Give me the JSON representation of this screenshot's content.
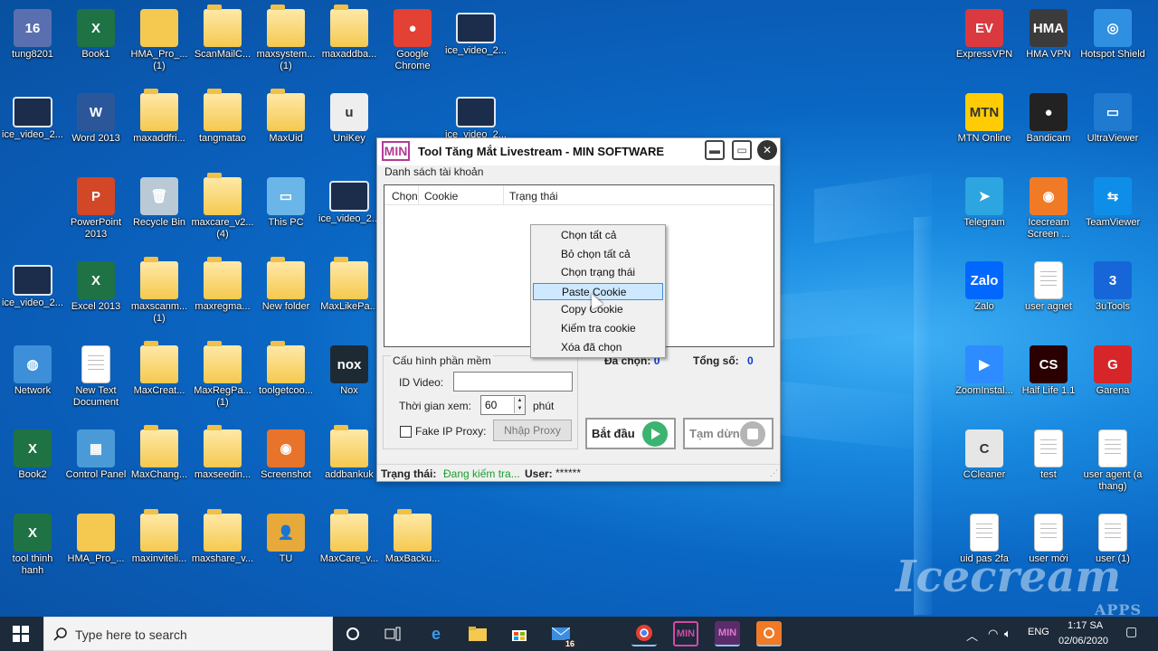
{
  "desktop": {
    "icons": [
      {
        "id": "tung8201",
        "label": "tung8201",
        "kind": "app",
        "color": "#5a6fb0",
        "glyph": "16"
      },
      {
        "id": "book1",
        "label": "Book1",
        "kind": "app",
        "color": "#1f7244",
        "glyph": "X"
      },
      {
        "id": "hma-pro-1",
        "label": "HMA_Pro_... (1)",
        "kind": "app",
        "color": "#f5c94f",
        "glyph": ""
      },
      {
        "id": "scanmailc",
        "label": "ScanMailC...",
        "kind": "folder"
      },
      {
        "id": "maxsystem-1",
        "label": "maxsystem... (1)",
        "kind": "folder"
      },
      {
        "id": "maxaddba",
        "label": "maxaddba...",
        "kind": "folder"
      },
      {
        "id": "google-chrome",
        "label": "Google Chrome",
        "kind": "app",
        "color": "#e34133",
        "glyph": "●"
      },
      {
        "id": "ice-video-1",
        "label": "ice_video_2...",
        "kind": "shot"
      },
      {
        "id": "ice-video-2",
        "label": "ice_video_2...",
        "kind": "shot"
      },
      {
        "id": "word-2013",
        "label": "Word 2013",
        "kind": "app",
        "color": "#2b579a",
        "glyph": "W"
      },
      {
        "id": "maxaddfri",
        "label": "maxaddfri...",
        "kind": "folder"
      },
      {
        "id": "tangmatao",
        "label": "tangmatao",
        "kind": "folder"
      },
      {
        "id": "maxuid",
        "label": "MaxUid",
        "kind": "folder"
      },
      {
        "id": "unikey",
        "label": "UniKey",
        "kind": "app",
        "color": "#eee",
        "glyph": "u"
      },
      {
        "id": "ice-video-3",
        "label": "ice_video_2...",
        "kind": "shot"
      },
      {
        "id": "powerpoint-2013",
        "label": "PowerPoint 2013",
        "kind": "app",
        "color": "#d24726",
        "glyph": "P"
      },
      {
        "id": "recycle-bin",
        "label": "Recycle Bin",
        "kind": "app",
        "color": "#b9c9d6",
        "glyph": "🗑"
      },
      {
        "id": "maxcare-v2-4",
        "label": "maxcare_v2... (4)",
        "kind": "folder"
      },
      {
        "id": "this-pc",
        "label": "This PC",
        "kind": "app",
        "color": "#6bb6e8",
        "glyph": "▭"
      },
      {
        "id": "ice-video-4",
        "label": "ice_video_2...",
        "kind": "shot"
      },
      {
        "id": "ice-video-5",
        "label": "ice_video_2...",
        "kind": "shot"
      },
      {
        "id": "excel-2013",
        "label": "Excel 2013",
        "kind": "app",
        "color": "#1f7244",
        "glyph": "X"
      },
      {
        "id": "maxscanm-1",
        "label": "maxscanm... (1)",
        "kind": "folder"
      },
      {
        "id": "maxregma",
        "label": "maxregma...",
        "kind": "folder"
      },
      {
        "id": "new-folder",
        "label": "New folder",
        "kind": "folder"
      },
      {
        "id": "maxlikepa",
        "label": "MaxLikePa...",
        "kind": "folder"
      },
      {
        "id": "network",
        "label": "Network",
        "kind": "app",
        "color": "#3c8fd8",
        "glyph": "◍"
      },
      {
        "id": "new-text-doc",
        "label": "New Text Document",
        "kind": "doc"
      },
      {
        "id": "maxcreat",
        "label": "MaxCreat...",
        "kind": "folder"
      },
      {
        "id": "maxregpa-1",
        "label": "MaxRegPa... (1)",
        "kind": "folder"
      },
      {
        "id": "toolgetcoo",
        "label": "toolgetcoo...",
        "kind": "folder"
      },
      {
        "id": "nox",
        "label": "Nox",
        "kind": "app",
        "color": "#1e2a33",
        "glyph": "nox"
      },
      {
        "id": "book2",
        "label": "Book2",
        "kind": "app",
        "color": "#1f7244",
        "glyph": "X"
      },
      {
        "id": "control-panel",
        "label": "Control Panel",
        "kind": "app",
        "color": "#4a9ad8",
        "glyph": "▦"
      },
      {
        "id": "maxchang",
        "label": "MaxChang...",
        "kind": "folder"
      },
      {
        "id": "maxseedin",
        "label": "maxseedin...",
        "kind": "folder"
      },
      {
        "id": "screenshot",
        "label": "Screenshot",
        "kind": "app",
        "color": "#e8742c",
        "glyph": "◉"
      },
      {
        "id": "addbankuk",
        "label": "addbankuk",
        "kind": "folder"
      },
      {
        "id": "tool-thinh-hanh",
        "label": "tool thinh hanh",
        "kind": "app",
        "color": "#1f7244",
        "glyph": "X"
      },
      {
        "id": "hma-pro-2",
        "label": "HMA_Pro_...",
        "kind": "app",
        "color": "#f5c94f",
        "glyph": ""
      },
      {
        "id": "maxinviteli",
        "label": "maxinviteli...",
        "kind": "folder"
      },
      {
        "id": "maxshare-v",
        "label": "maxshare_v...",
        "kind": "folder"
      },
      {
        "id": "tu",
        "label": "TU",
        "kind": "app",
        "color": "#e6a93a",
        "glyph": "👤"
      },
      {
        "id": "maxcare-v",
        "label": "MaxCare_v...",
        "kind": "folder"
      },
      {
        "id": "maxbacku",
        "label": "MaxBacku...",
        "kind": "folder"
      },
      {
        "id": "expressvpn",
        "label": "ExpressVPN",
        "kind": "app",
        "color": "#da3940",
        "glyph": "EV"
      },
      {
        "id": "hma-vpn",
        "label": "HMA VPN",
        "kind": "app",
        "color": "#3b3b3b",
        "glyph": "HMA"
      },
      {
        "id": "hotspot-shield",
        "label": "Hotspot Shield",
        "kind": "app",
        "color": "#2f8fe0",
        "glyph": "◎"
      },
      {
        "id": "mtn-online",
        "label": "MTN Online",
        "kind": "app",
        "color": "#ffcb05",
        "glyph": "MTN"
      },
      {
        "id": "bandicam",
        "label": "Bandicam",
        "kind": "app",
        "color": "#222",
        "glyph": "●"
      },
      {
        "id": "ultraviewer",
        "label": "UltraViewer",
        "kind": "app",
        "color": "#1f7ad0",
        "glyph": "▭"
      },
      {
        "id": "telegram",
        "label": "Telegram",
        "kind": "app",
        "color": "#2ca5e0",
        "glyph": "➤"
      },
      {
        "id": "icecream-screen",
        "label": "Icecream Screen ...",
        "kind": "app",
        "color": "#f07a26",
        "glyph": "◉"
      },
      {
        "id": "teamviewer",
        "label": "TeamViewer",
        "kind": "app",
        "color": "#0e8ee9",
        "glyph": "⇆"
      },
      {
        "id": "zalo",
        "label": "Zalo",
        "kind": "app",
        "color": "#0068ff",
        "glyph": "Zalo"
      },
      {
        "id": "user-agnet",
        "label": "user agnet",
        "kind": "doc"
      },
      {
        "id": "3utools",
        "label": "3uTools",
        "kind": "app",
        "color": "#1666d8",
        "glyph": "3"
      },
      {
        "id": "zoominstal",
        "label": "ZoomInstal...",
        "kind": "app",
        "color": "#2d8cff",
        "glyph": "▶"
      },
      {
        "id": "half-life",
        "label": "Half Life 1.1",
        "kind": "app",
        "color": "#2a0000",
        "glyph": "CS"
      },
      {
        "id": "garena",
        "label": "Garena",
        "kind": "app",
        "color": "#d7262a",
        "glyph": "G"
      },
      {
        "id": "ccleaner",
        "label": "CCleaner",
        "kind": "app",
        "color": "#e6e6e6",
        "glyph": "C"
      },
      {
        "id": "test",
        "label": "test",
        "kind": "doc"
      },
      {
        "id": "user-agent-a-thang",
        "label": "user agent (a thang)",
        "kind": "doc"
      },
      {
        "id": "uid-pas-2fa",
        "label": "uid pas 2fa",
        "kind": "doc"
      },
      {
        "id": "user-moi",
        "label": "user mới",
        "kind": "doc"
      },
      {
        "id": "user-1",
        "label": "user (1)",
        "kind": "doc"
      }
    ],
    "watermark": {
      "brand": "Icecream",
      "sub": "APPS"
    }
  },
  "window": {
    "logo": "MIN",
    "title": "Tool Tăng Mắt Livestream - MIN SOFTWARE",
    "account_group": "Danh sách tài khoản",
    "columns": [
      "Chọn",
      "Cookie",
      "Trạng thái"
    ],
    "config_group": "Cấu hình phần mềm",
    "id_video_label": "ID Video:",
    "id_video_value": "",
    "watch_time_label": "Thời gian xem:",
    "watch_time_value": "60",
    "watch_time_unit": "phút",
    "proxy_label": "Fake IP Proxy:",
    "proxy_button": "Nhập Proxy",
    "selected_label": "Đã chọn:",
    "selected_value": "0",
    "total_label": "Tổng số:",
    "total_value": "0",
    "start_button": "Bắt đầu",
    "pause_button": "Tạm dừng",
    "status_label": "Trạng thái:",
    "status_value": "Đang kiếm tra...",
    "user_label": "User:",
    "user_value": "******",
    "colors": {
      "accent": "#b43a96",
      "status_green": "#1a9e2c",
      "count_blue": "#0a3bd6",
      "play_green": "#3cb371"
    }
  },
  "context_menu": {
    "items": [
      "Chọn tất cả",
      "Bỏ chọn tất cả",
      "Chọn trạng thái",
      "Paste Cookie",
      "Copy Cookie",
      "Kiếm tra cookie",
      "Xóa đã chọn"
    ],
    "highlighted": "Paste Cookie"
  },
  "taskbar": {
    "search_placeholder": "Type here to search",
    "mail_badge": "16",
    "language": "ENG",
    "time": "1:17 SA",
    "date": "02/06/2020"
  }
}
